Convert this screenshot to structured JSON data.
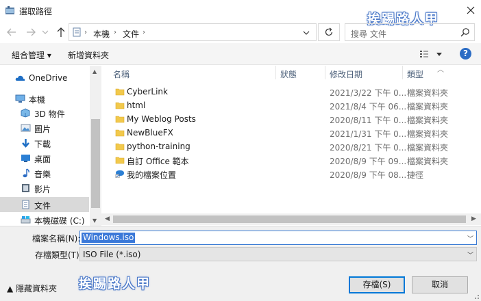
{
  "window": {
    "title": "選取路徑",
    "watermark": "挨踢路人甲"
  },
  "nav": {
    "path": [
      "本機",
      "文件"
    ],
    "search_placeholder": "搜尋 文件"
  },
  "toolbar": {
    "organize": "組合管理 ▾",
    "new_folder": "新增資料夾",
    "help": "?"
  },
  "sidebar": {
    "items": [
      {
        "label": "OneDrive",
        "icon": "cloud-icon"
      },
      {
        "label": "本機",
        "icon": "computer-icon"
      },
      {
        "label": "3D 物件",
        "icon": "3d-objects-icon"
      },
      {
        "label": "圖片",
        "icon": "pictures-icon"
      },
      {
        "label": "下載",
        "icon": "download-icon"
      },
      {
        "label": "桌面",
        "icon": "desktop-icon"
      },
      {
        "label": "音樂",
        "icon": "music-icon"
      },
      {
        "label": "影片",
        "icon": "video-icon"
      },
      {
        "label": "文件",
        "icon": "documents-icon",
        "selected": true
      },
      {
        "label": "本機磁碟 (C:)",
        "icon": "drive-icon"
      }
    ]
  },
  "filelist": {
    "columns": {
      "name": "名稱",
      "status": "狀態",
      "date": "修改日期",
      "type": "類型"
    },
    "rows": [
      {
        "name": "CyberLink",
        "date": "2021/3/22 下午 0...",
        "type": "檔案資料夾",
        "icon": "folder-icon"
      },
      {
        "name": "html",
        "date": "2021/8/4 下午 06...",
        "type": "檔案資料夾",
        "icon": "folder-icon"
      },
      {
        "name": "My Weblog Posts",
        "date": "2020/8/11 下午 0...",
        "type": "檔案資料夾",
        "icon": "folder-icon"
      },
      {
        "name": "NewBlueFX",
        "date": "2021/1/31 下午 0...",
        "type": "檔案資料夾",
        "icon": "folder-icon"
      },
      {
        "name": "python-training",
        "date": "2020/8/21 下午 0...",
        "type": "檔案資料夾",
        "icon": "folder-icon"
      },
      {
        "name": "自訂 Office 範本",
        "date": "2020/8/9 下午 09...",
        "type": "檔案資料夾",
        "icon": "folder-icon"
      },
      {
        "name": "我的檔案位置",
        "date": "2020/8/9 下午 08...",
        "type": "捷徑",
        "icon": "shortcut-icon"
      }
    ]
  },
  "bottom": {
    "filename_label": "檔案名稱(N):",
    "filename_value": "Windows.iso",
    "filetype_label": "存檔類型(T):",
    "filetype_value": "ISO File (*.iso)",
    "hide_folders": "▲  隱藏資料夾",
    "save": "存檔(S)",
    "cancel": "取消"
  }
}
